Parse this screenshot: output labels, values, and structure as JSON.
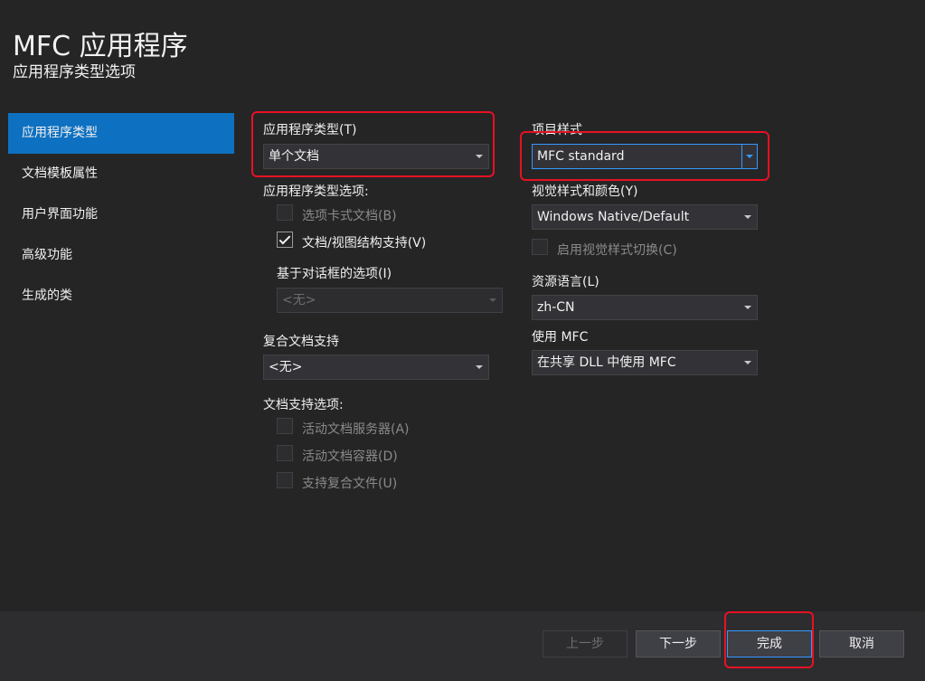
{
  "header": {
    "title": "MFC 应用程序",
    "subtitle": "应用程序类型选项"
  },
  "sidebar": {
    "items": [
      {
        "label": "应用程序类型",
        "active": true
      },
      {
        "label": "文档模板属性",
        "active": false
      },
      {
        "label": "用户界面功能",
        "active": false
      },
      {
        "label": "高级功能",
        "active": false
      },
      {
        "label": "生成的类",
        "active": false
      }
    ]
  },
  "app_type": {
    "label": "应用程序类型(T)",
    "value": "单个文档",
    "options_label": "应用程序类型选项:",
    "tabbed_docs": {
      "label": "选项卡式文档(B)",
      "checked": false,
      "enabled": false
    },
    "doc_view": {
      "label": "文档/视图结构支持(V)",
      "checked": true,
      "enabled": true
    },
    "dialog_options_label": "基于对话框的选项(I)",
    "dialog_options_value": "<无>"
  },
  "compound": {
    "label": "复合文档支持",
    "value": "<无>"
  },
  "doc_support": {
    "label": "文档支持选项:",
    "active_server": {
      "label": "活动文档服务器(A)",
      "checked": false,
      "enabled": false
    },
    "active_container": {
      "label": "活动文档容器(D)",
      "checked": false,
      "enabled": false
    },
    "compound_files": {
      "label": "支持复合文件(U)",
      "checked": false,
      "enabled": false
    }
  },
  "project_style": {
    "label": "项目样式",
    "value": "MFC standard"
  },
  "visual_style": {
    "label": "视觉样式和颜色(Y)",
    "value": "Windows Native/Default",
    "switch": {
      "label": "启用视觉样式切换(C)",
      "checked": false,
      "enabled": false
    }
  },
  "resource_lang": {
    "label": "资源语言(L)",
    "value": "zh-CN"
  },
  "use_mfc": {
    "label": "使用 MFC",
    "value": "在共享 DLL 中使用 MFC"
  },
  "footer": {
    "prev": "上一步",
    "next": "下一步",
    "finish": "完成",
    "cancel": "取消"
  },
  "colors": {
    "accent": "#0e70c0",
    "focus": "#3399ff",
    "highlight": "#e81123",
    "background": "#252526"
  }
}
